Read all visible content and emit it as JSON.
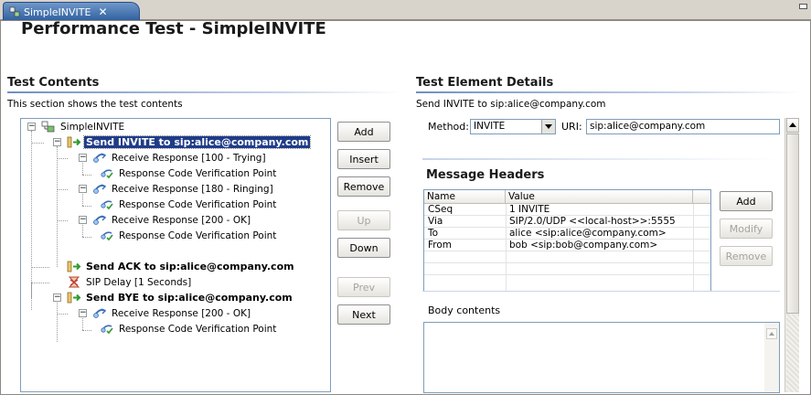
{
  "tab": {
    "label": "SimpleINVITE",
    "close_glyph": "✕"
  },
  "page_title": "Performance Test - SimpleINVITE",
  "test_contents": {
    "title": "Test Contents",
    "description": "This section shows the test contents",
    "tree": [
      {
        "label": "SimpleINVITE",
        "icon": "test-icon"
      },
      {
        "label": "Send INVITE to sip:alice@company.com",
        "icon": "send-request-icon"
      },
      {
        "label": "Receive Response [100 - Trying]",
        "icon": "receive-response-icon"
      },
      {
        "label": "Response Code Verification Point",
        "icon": "verification-point-icon"
      },
      {
        "label": "Receive Response [180 - Ringing]",
        "icon": "receive-response-icon"
      },
      {
        "label": "Response Code Verification Point",
        "icon": "verification-point-icon"
      },
      {
        "label": "Receive Response [200 - OK]",
        "icon": "receive-response-icon"
      },
      {
        "label": "Response Code Verification Point",
        "icon": "verification-point-icon"
      },
      {
        "label": "Send ACK to sip:alice@company.com",
        "icon": "send-request-icon"
      },
      {
        "label": "SIP Delay [1 Seconds]",
        "icon": "delay-icon"
      },
      {
        "label": "Send BYE to sip:alice@company.com",
        "icon": "send-request-icon"
      },
      {
        "label": "Receive Response [200 - OK]",
        "icon": "receive-response-icon"
      },
      {
        "label": "Response Code Verification Point",
        "icon": "verification-point-icon"
      }
    ],
    "buttons": {
      "add": "Add",
      "insert": "Insert",
      "remove": "Remove",
      "up": "Up",
      "down": "Down",
      "prev": "Prev",
      "next": "Next"
    }
  },
  "details": {
    "title": "Test Element Details",
    "element_label": "Send INVITE to sip:alice@company.com",
    "method_label": "Method:",
    "method_value": "INVITE",
    "uri_label": "URI:",
    "uri_value": "sip:alice@company.com",
    "headers": {
      "title": "Message Headers",
      "columns": [
        "Name",
        "Value"
      ],
      "rows": [
        {
          "name": "CSeq",
          "value": "1 INVITE"
        },
        {
          "name": "Via",
          "value": "SIP/2.0/UDP <<local-host>>:5555"
        },
        {
          "name": "To",
          "value": "alice <sip:alice@company.com>"
        },
        {
          "name": "From",
          "value": "bob <sip:bob@company.com>"
        }
      ],
      "buttons": {
        "add": "Add",
        "modify": "Modify",
        "remove": "Remove"
      }
    },
    "body_label": "Body contents"
  },
  "colors": {
    "selection": "#1f3c88",
    "tab": "#2f5f9e",
    "section_line": "#6f8fc0"
  }
}
